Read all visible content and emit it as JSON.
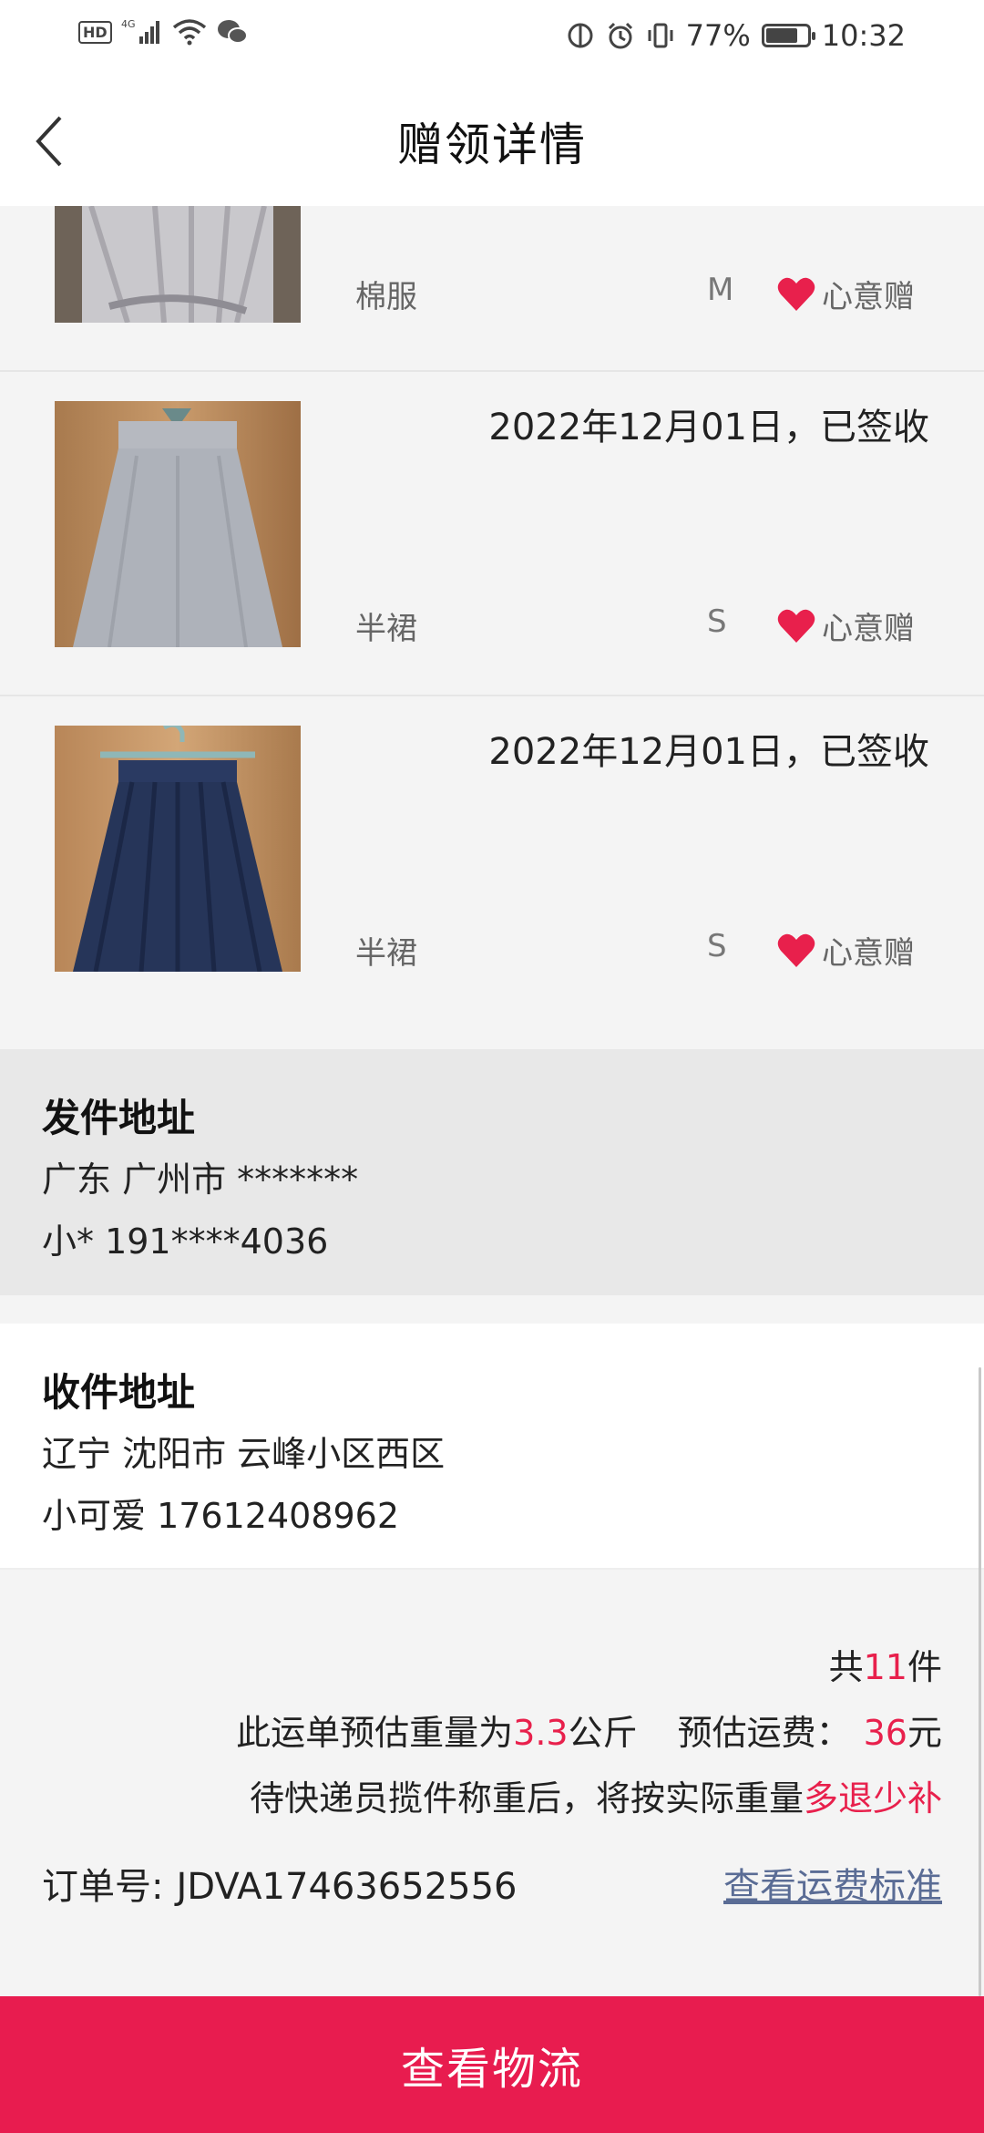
{
  "status_bar": {
    "hd": "HD",
    "network": "4G",
    "battery_percent": "77%",
    "battery_level": 0.77,
    "time": "10:32"
  },
  "header": {
    "title": "赠领详情"
  },
  "items": [
    {
      "date": "",
      "name": "棉服",
      "size": "M",
      "tag": "心意赠"
    },
    {
      "date": "2022年12月01日，已签收",
      "name": "半裙",
      "size": "S",
      "tag": "心意赠"
    },
    {
      "date": "2022年12月01日，已签收",
      "name": "半裙",
      "size": "S",
      "tag": "心意赠"
    }
  ],
  "sender": {
    "title": "发件地址",
    "address": "广东 广州市 *******",
    "contact": "小* 191****4036"
  },
  "receiver": {
    "title": "收件地址",
    "address": "辽宁 沈阳市 云峰小区西区",
    "contact": "小可爱 17612408962"
  },
  "summary": {
    "count_prefix": "共",
    "count": "11",
    "count_suffix": "件",
    "weight_prefix": "此运单预估重量为",
    "weight": "3.3",
    "weight_unit": "公斤",
    "fee_label": "预估运费：",
    "fee": "36",
    "fee_unit": "元",
    "note_prefix": "待快递员揽件称重后，将按实际重量",
    "note_highlight": "多退少补",
    "order_label": "订单号:",
    "order_no": "JDVA17463652556",
    "fee_standard_link": "查看运费标准"
  },
  "bottom_button": {
    "label": "查看物流"
  },
  "colors": {
    "accent": "#e81c4f",
    "link": "#5a6c95",
    "heart": "#e8204c"
  }
}
